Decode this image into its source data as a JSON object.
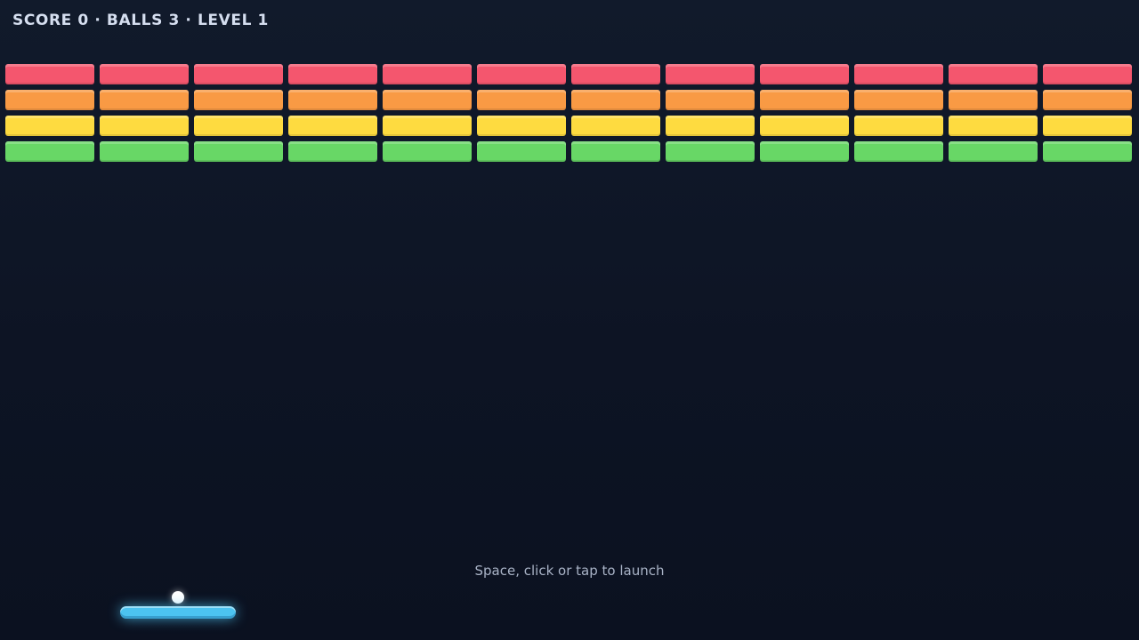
{
  "hud": {
    "text": "SCORE 0 · BALLS 3 · LEVEL 1",
    "score": 0,
    "balls": 3,
    "level": 1
  },
  "bricks": {
    "columns": 12,
    "rows": [
      {
        "color": "#f4566e",
        "name": "red"
      },
      {
        "color": "#f99a44",
        "name": "orange"
      },
      {
        "color": "#fedb40",
        "name": "yellow"
      },
      {
        "color": "#68d766",
        "name": "green"
      }
    ]
  },
  "prompt": "Space, click or tap to launch",
  "colors": {
    "background": "#0d1424",
    "paddle": "#4cc3f0",
    "ball": "#ffffff",
    "hud_text": "#d5deef"
  }
}
